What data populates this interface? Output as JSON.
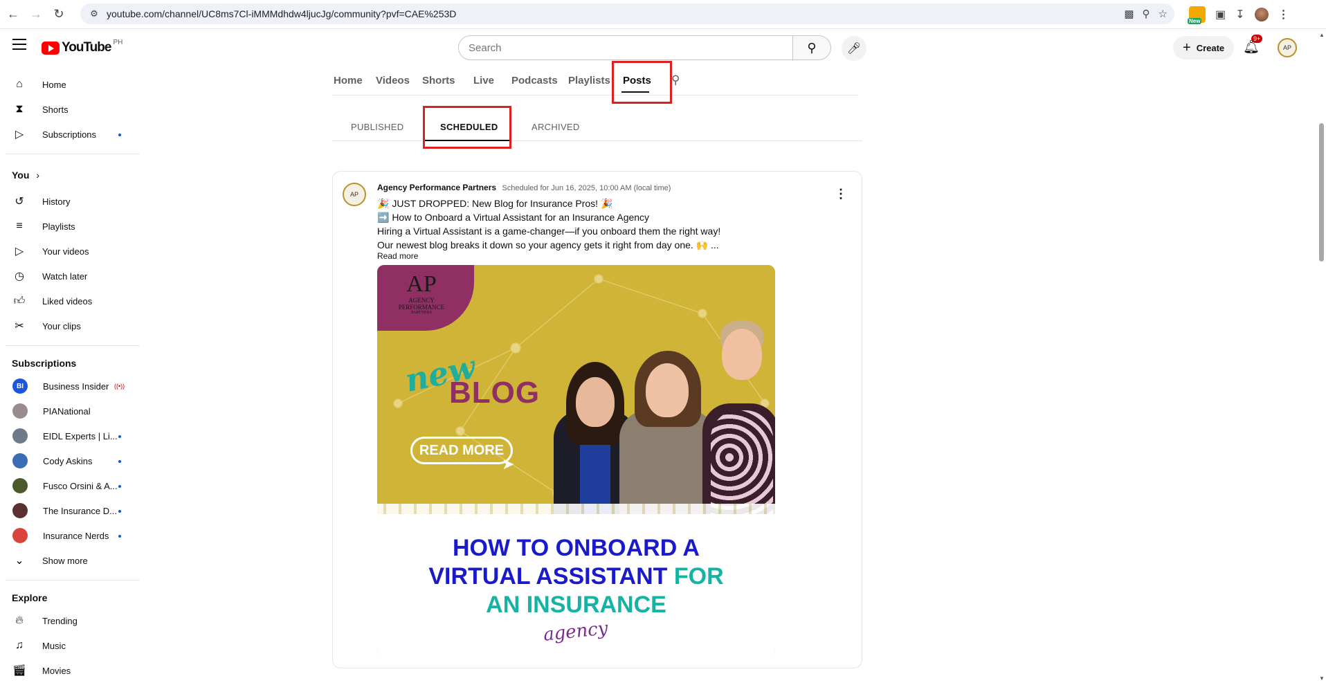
{
  "browser": {
    "url": "youtube.com/channel/UC8ms7Cl-iMMMdhdw4ljucJg/community?pvf=CAE%253D",
    "ext_new_label": "New"
  },
  "masthead": {
    "logo_text": "YouTube",
    "country_code": "PH",
    "search_placeholder": "Search",
    "create_label": "Create",
    "notification_count": "9+"
  },
  "sidebar": {
    "main": [
      {
        "label": "Home",
        "icon": "home-icon"
      },
      {
        "label": "Shorts",
        "icon": "shorts-icon"
      },
      {
        "label": "Subscriptions",
        "icon": "subscriptions-icon"
      }
    ],
    "you_heading": "You",
    "you_items": [
      {
        "label": "History",
        "icon": "history-icon"
      },
      {
        "label": "Playlists",
        "icon": "playlists-icon"
      },
      {
        "label": "Your videos",
        "icon": "your-videos-icon"
      },
      {
        "label": "Watch later",
        "icon": "watch-later-icon"
      },
      {
        "label": "Liked videos",
        "icon": "liked-videos-icon"
      },
      {
        "label": "Your clips",
        "icon": "clips-icon"
      }
    ],
    "subscriptions_heading": "Subscriptions",
    "subscriptions": [
      {
        "label": "Business Insider",
        "avatar_text": "BI",
        "color": "#1a56db"
      },
      {
        "label": "PIANational",
        "avatar_text": "",
        "color": "#9a8c8c"
      },
      {
        "label": "EIDL Experts | Li...",
        "avatar_text": "",
        "color": "#6c7a89"
      },
      {
        "label": "Cody Askins",
        "avatar_text": "",
        "color": "#3b6db5"
      },
      {
        "label": "Fusco Orsini & A...",
        "avatar_text": "",
        "color": "#4a5a2a"
      },
      {
        "label": "The Insurance D...",
        "avatar_text": "",
        "color": "#5a3030"
      },
      {
        "label": "Insurance Nerds",
        "avatar_text": "",
        "color": "#d9453a"
      }
    ],
    "show_more": "Show more",
    "explore_heading": "Explore",
    "explore": [
      {
        "label": "Trending",
        "icon": "trending-icon"
      },
      {
        "label": "Music",
        "icon": "music-icon"
      },
      {
        "label": "Movies",
        "icon": "movies-icon"
      }
    ]
  },
  "channel_tabs": [
    "Home",
    "Videos",
    "Shorts",
    "Live",
    "Podcasts",
    "Playlists",
    "Posts"
  ],
  "active_channel_tab": "Posts",
  "post_tabs": [
    "PUBLISHED",
    "SCHEDULED",
    "ARCHIVED"
  ],
  "active_post_tab": "SCHEDULED",
  "post": {
    "author": "Agency Performance Partners",
    "scheduled": "Scheduled for Jun 16, 2025, 10:00 AM (local time)",
    "lines": [
      "🎉 JUST DROPPED: New Blog for Insurance Pros! 🎉",
      "➡️ How to Onboard a Virtual Assistant for an Insurance Agency",
      "Hiring a Virtual Assistant is a game-changer—if you onboard them the right way!",
      "Our newest blog breaks it down so your agency gets it right from day one. 🙌 ..."
    ],
    "read_more": "Read more",
    "image": {
      "logo_mark": "AP",
      "logo_text": "AGENCY PERFORMANCE",
      "logo_subtext": "PARTNERS",
      "new_word": "new",
      "blog_word": "BLOG",
      "read_more_button": "READ MORE",
      "headline_1": "HOW TO ONBOARD A",
      "headline_2a": "VIRTUAL ASSISTANT",
      "headline_2b": "FOR",
      "headline_3": "AN INSURANCE",
      "headline_4": "agency"
    }
  }
}
